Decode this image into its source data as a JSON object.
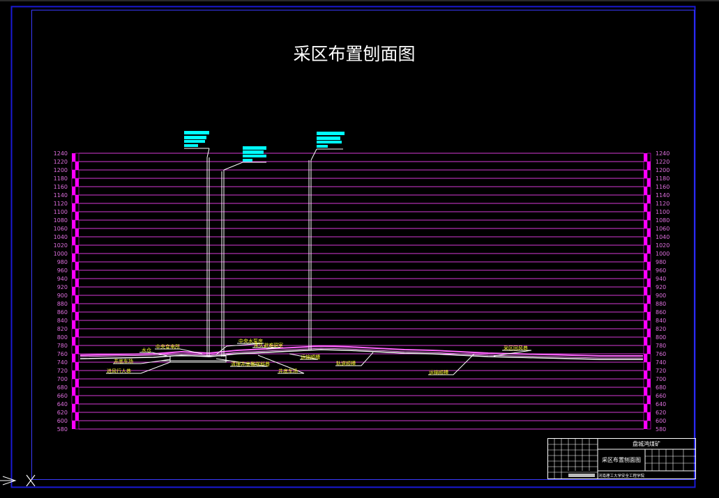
{
  "drawing": {
    "title": "采区布置刨面图",
    "elevation_levels": [
      1240,
      1220,
      1200,
      1180,
      1160,
      1140,
      1120,
      1100,
      1080,
      1060,
      1040,
      1020,
      1000,
      980,
      960,
      940,
      920,
      900,
      880,
      860,
      840,
      820,
      800,
      780,
      760,
      740,
      720,
      700,
      680,
      660,
      640,
      620,
      600,
      580
    ],
    "annotations": [
      {
        "id": "shuicang",
        "text": "水仓"
      },
      {
        "id": "zhongyang-biandiansuo",
        "text": "中央变电所"
      },
      {
        "id": "zhongyang-shuibengfang",
        "text": "中央水泵房"
      },
      {
        "id": "jingdi-chechang-1",
        "text": "井底车场"
      },
      {
        "id": "yongjiu-bidao-jiqiang",
        "text": "永久避难硐室"
      },
      {
        "id": "huifeng-xingrenxiang",
        "text": "进风行人巷"
      },
      {
        "id": "qingli-jingdi-xianxiexiang",
        "text": "清理井底撒煤斜巷"
      },
      {
        "id": "jingdi-chechang-2",
        "text": "井底车场"
      },
      {
        "id": "yunshu-shangshan",
        "text": "运输顺槽"
      },
      {
        "id": "guidao-shunshan",
        "text": "轨道顺槽"
      },
      {
        "id": "jinfeng-shunshan",
        "text": "运输顺槽"
      },
      {
        "id": "caiqu-huifengxiang",
        "text": "采区回风巷"
      }
    ]
  },
  "title_block": {
    "company": "盘城鸿煤矿",
    "drawing_name": "采区布置刨面图",
    "institution": "河南理工大学安全工程学院"
  },
  "colors": {
    "background": "#000000",
    "border": "#1a1ad6",
    "grid_line": "#d63ad6",
    "scale_bar": "#ff00ff",
    "label": "#e070e0",
    "annotation": "#ffff33",
    "shaft": "#ffffff",
    "callout": "#00ffff",
    "title": "#ffffff"
  },
  "icons": {
    "ucs": "ucs-axis-icon",
    "crosshair": "cursor-crosshair-icon"
  }
}
